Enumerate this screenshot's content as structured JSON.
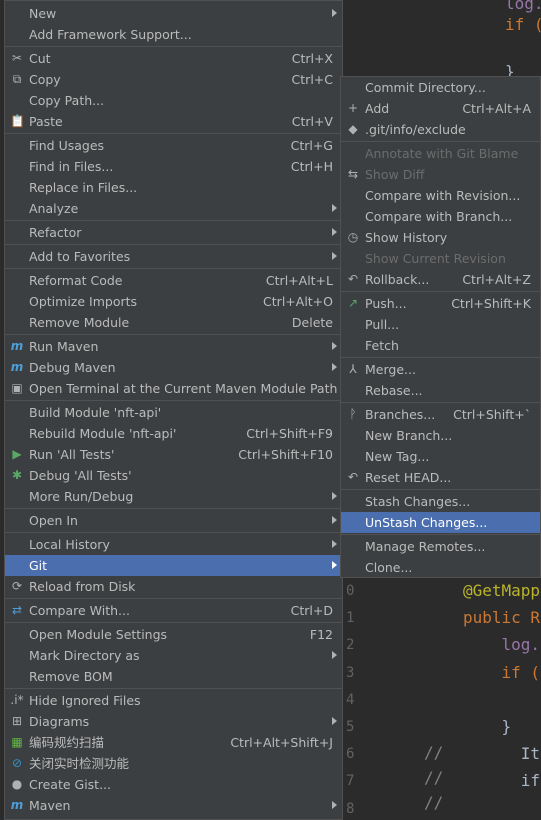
{
  "main_menu": [
    {
      "label": "New",
      "submenu": true
    },
    {
      "label": "Add Framework Support..."
    },
    {
      "sep": true
    },
    {
      "label": "Cut",
      "shortcut": "Ctrl+X",
      "icon": "scissors-icon",
      "glyph": "✂"
    },
    {
      "label": "Copy",
      "shortcut": "Ctrl+C",
      "icon": "copy-icon",
      "glyph": "⧉"
    },
    {
      "label": "Copy Path..."
    },
    {
      "label": "Paste",
      "shortcut": "Ctrl+V",
      "icon": "paste-icon",
      "glyph": "📋"
    },
    {
      "sep": true
    },
    {
      "label": "Find Usages",
      "shortcut": "Ctrl+G"
    },
    {
      "label": "Find in Files...",
      "shortcut": "Ctrl+H"
    },
    {
      "label": "Replace in Files..."
    },
    {
      "label": "Analyze",
      "submenu": true
    },
    {
      "sep": true
    },
    {
      "label": "Refactor",
      "submenu": true
    },
    {
      "sep": true
    },
    {
      "label": "Add to Favorites",
      "submenu": true
    },
    {
      "sep": true
    },
    {
      "label": "Reformat Code",
      "shortcut": "Ctrl+Alt+L"
    },
    {
      "label": "Optimize Imports",
      "shortcut": "Ctrl+Alt+O"
    },
    {
      "label": "Remove Module",
      "shortcut": "Delete"
    },
    {
      "sep": true
    },
    {
      "label": "Run Maven",
      "submenu": true,
      "icon": "maven-run-icon",
      "glyph": "m"
    },
    {
      "label": "Debug Maven",
      "submenu": true,
      "icon": "maven-debug-icon",
      "glyph": "m"
    },
    {
      "label": "Open Terminal at the Current Maven Module Path",
      "icon": "terminal-icon",
      "glyph": "▣"
    },
    {
      "sep": true
    },
    {
      "label": "Build Module 'nft-api'"
    },
    {
      "label": "Rebuild Module 'nft-api'",
      "shortcut": "Ctrl+Shift+F9"
    },
    {
      "label": "Run 'All Tests'",
      "shortcut": "Ctrl+Shift+F10",
      "icon": "run-icon",
      "glyph": "▶"
    },
    {
      "label": "Debug 'All Tests'",
      "icon": "debug-icon",
      "glyph": "✱"
    },
    {
      "label": "More Run/Debug",
      "submenu": true
    },
    {
      "sep": true
    },
    {
      "label": "Open In",
      "submenu": true
    },
    {
      "sep": true
    },
    {
      "label": "Local History",
      "submenu": true
    },
    {
      "label": "Git",
      "submenu": true,
      "selected": true
    },
    {
      "label": "Reload from Disk",
      "icon": "reload-icon",
      "glyph": "⟳"
    },
    {
      "sep": true
    },
    {
      "label": "Compare With...",
      "shortcut": "Ctrl+D",
      "icon": "compare-icon",
      "glyph": "⇄"
    },
    {
      "sep": true
    },
    {
      "label": "Open Module Settings",
      "shortcut": "F12"
    },
    {
      "label": "Mark Directory as",
      "submenu": true
    },
    {
      "label": "Remove BOM"
    },
    {
      "sep": true
    },
    {
      "label": "Hide Ignored Files",
      "icon": "ignore-icon",
      "glyph": ".i*"
    },
    {
      "label": "Diagrams",
      "submenu": true,
      "icon": "diagram-icon",
      "glyph": "⊞"
    },
    {
      "label": "编码规约扫描",
      "shortcut": "Ctrl+Alt+Shift+J",
      "icon": "scan-icon",
      "glyph": "▦"
    },
    {
      "label": "关闭实时检测功能",
      "icon": "disable-icon",
      "glyph": "⊘"
    },
    {
      "label": "Create Gist...",
      "icon": "github-icon",
      "glyph": "●"
    },
    {
      "label": "Maven",
      "submenu": true,
      "icon": "maven-icon",
      "glyph": "m"
    }
  ],
  "git_menu": [
    {
      "label": "Commit Directory..."
    },
    {
      "label": "Add",
      "shortcut": "Ctrl+Alt+A",
      "icon": "plus-icon",
      "glyph": "+"
    },
    {
      "label": ".git/info/exclude",
      "icon": "exclude-icon",
      "glyph": "◆"
    },
    {
      "sep": true
    },
    {
      "label": "Annotate with Git Blame",
      "disabled": true
    },
    {
      "label": "Show Diff",
      "disabled": true,
      "icon": "diff-icon",
      "glyph": "⇆"
    },
    {
      "label": "Compare with Revision..."
    },
    {
      "label": "Compare with Branch..."
    },
    {
      "label": "Show History",
      "icon": "history-icon",
      "glyph": "◷"
    },
    {
      "label": "Show Current Revision",
      "disabled": true
    },
    {
      "label": "Rollback...",
      "shortcut": "Ctrl+Alt+Z",
      "icon": "rollback-icon",
      "glyph": "↶"
    },
    {
      "sep": true
    },
    {
      "label": "Push...",
      "shortcut": "Ctrl+Shift+K",
      "icon": "push-icon",
      "glyph": "↗"
    },
    {
      "label": "Pull..."
    },
    {
      "label": "Fetch"
    },
    {
      "sep": true
    },
    {
      "label": "Merge...",
      "icon": "merge-icon",
      "glyph": "⅄"
    },
    {
      "label": "Rebase..."
    },
    {
      "sep": true
    },
    {
      "label": "Branches...",
      "shortcut": "Ctrl+Shift+`",
      "icon": "branch-icon",
      "glyph": "ᚹ"
    },
    {
      "label": "New Branch..."
    },
    {
      "label": "New Tag..."
    },
    {
      "label": "Reset HEAD...",
      "icon": "reset-icon",
      "glyph": "↶"
    },
    {
      "sep": true
    },
    {
      "label": "Stash Changes..."
    },
    {
      "label": "UnStash Changes...",
      "selected": true
    },
    {
      "sep": true
    },
    {
      "label": "Manage Remotes..."
    },
    {
      "label": "Clone..."
    }
  ],
  "editor": {
    "gutter": [
      "0",
      "1",
      "2",
      "3",
      "4",
      "5",
      "6",
      "7",
      "8"
    ],
    "code_lines": [
      {
        "text": "@GetMapp",
        "cls": "ann"
      },
      {
        "text": "public R",
        "cls": "kw"
      },
      {
        "text": "    log.",
        "cls": "log"
      },
      {
        "text": "    if (",
        "cls": "kw"
      },
      {
        "text": "",
        "cls": "plain"
      },
      {
        "text": "    }",
        "cls": "plain"
      },
      {
        "text": "      It",
        "cls": "plain"
      },
      {
        "text": "      if",
        "cls": "plain"
      },
      {
        "text": "",
        "cls": "plain"
      }
    ],
    "top_lines": [
      {
        "text": "log.",
        "cls": "log"
      },
      {
        "text": "if (",
        "cls": "kw"
      }
    ],
    "comment_marks": [
      "//",
      "//",
      "//"
    ]
  }
}
